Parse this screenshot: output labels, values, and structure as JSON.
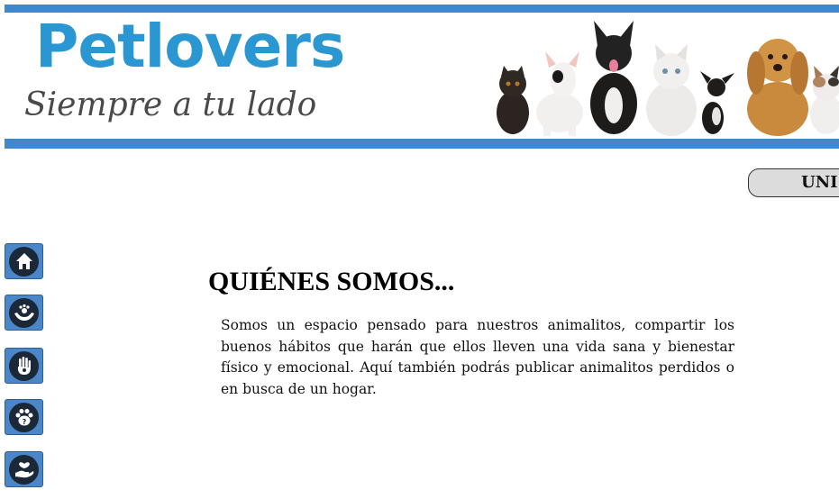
{
  "banner": {
    "title": "Petlovers",
    "tagline": "Siempre a tu lado",
    "brand_color": "#2a96d2",
    "accent_color": "#4287cc"
  },
  "nav": {
    "item_label": "UNI"
  },
  "sidebar": {
    "items": [
      {
        "icon": "home-icon"
      },
      {
        "icon": "pet-care-icon"
      },
      {
        "icon": "paw-hand-icon"
      },
      {
        "icon": "lost-pet-icon"
      },
      {
        "icon": "adoption-heart-icon"
      }
    ]
  },
  "main": {
    "heading": "QUIÉNES SOMOS...",
    "body": "Somos un espacio pensado para nuestros animalitos, compartir los buenos hábitos que harán que ellos lleven una vida sana y bienestar físico y emocional. Aquí también podrás publicar animalitos perdidos o en busca de un hogar."
  }
}
